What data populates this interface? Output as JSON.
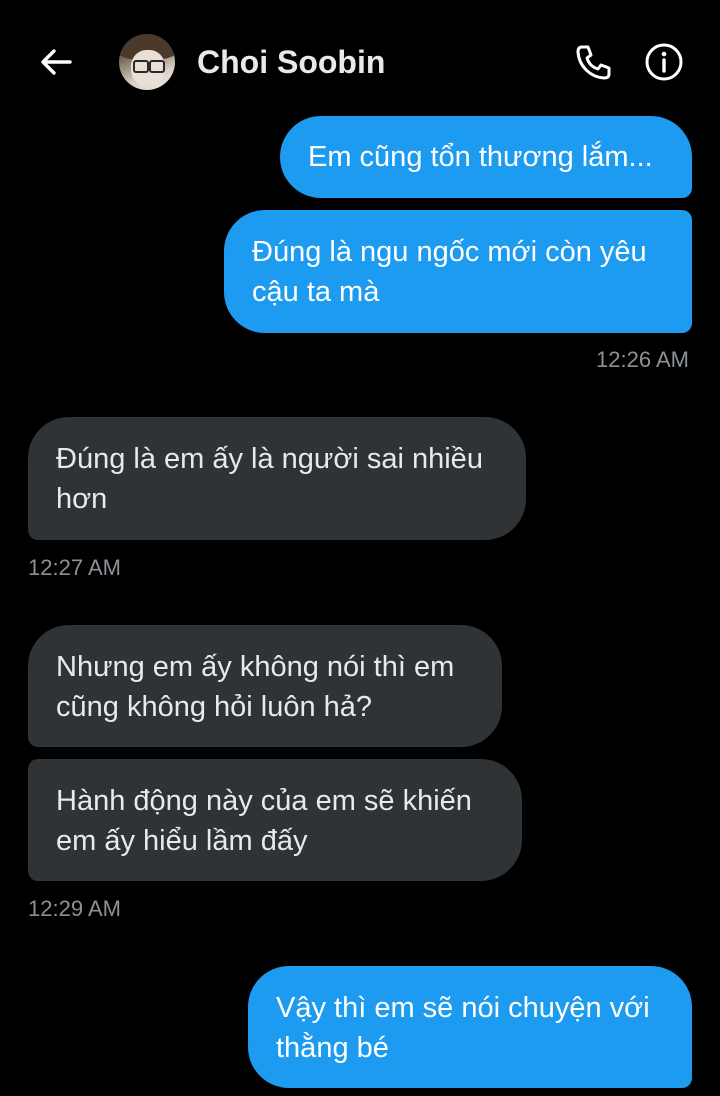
{
  "header": {
    "contact_name": "Choi Soobin",
    "back_icon": "arrow-left-icon",
    "call_icon": "phone-icon",
    "info_icon": "info-icon"
  },
  "colors": {
    "background": "#000000",
    "outgoing_bubble": "#1d9bf0",
    "incoming_bubble": "#2f3336",
    "timestamp": "#8b9196"
  },
  "messages": [
    {
      "direction": "outgoing",
      "lines": [
        "Em cũng tổn thương lắm..."
      ]
    },
    {
      "direction": "outgoing",
      "lines": [
        "Đúng là ngu ngốc mới còn yêu",
        "cậu ta mà"
      ],
      "time": "12:26 AM"
    },
    {
      "direction": "incoming",
      "lines": [
        "Đúng là em ấy là người sai nhiều",
        "hơn"
      ],
      "time": "12:27 AM"
    },
    {
      "direction": "incoming",
      "lines": [
        "Nhưng em ấy không nói thì em",
        "cũng không hỏi luôn hả?"
      ]
    },
    {
      "direction": "incoming",
      "lines": [
        "Hành động này của em sẽ khiến",
        "em ấy hiểu lầm đấy"
      ],
      "time": "12:29 AM"
    },
    {
      "direction": "outgoing",
      "lines": [
        "Vậy thì em sẽ nói chuyện với",
        "thằng bé"
      ]
    }
  ]
}
